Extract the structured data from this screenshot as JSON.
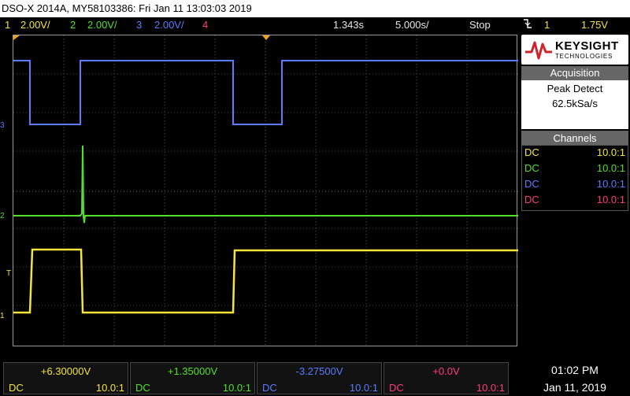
{
  "title": "DSO-X 2014A, MY58103386: Fri Jan 11 13:03:03 2019",
  "topbar": {
    "ch1": {
      "num": "1",
      "scale": "2.00V/"
    },
    "ch2": {
      "num": "2",
      "scale": "2.00V/"
    },
    "ch3": {
      "num": "3",
      "scale": "2.00V/"
    },
    "ch4": {
      "num": "4"
    },
    "time_delay": "1.343s",
    "time_scale": "5.000s/",
    "run_state": "Stop",
    "trigger_icon": "falling-edge-trigger-icon",
    "trigger_channel": "1",
    "trigger_level": "1.75V"
  },
  "markers": {
    "ch1": "1",
    "ch2": "2",
    "ch3": "3",
    "trigger": "T"
  },
  "logo": {
    "brand": "KEYSIGHT",
    "sub": "TECHNOLOGIES"
  },
  "acquisition": {
    "header": "Acquisition",
    "mode": "Peak Detect",
    "rate": "62.5kSa/s"
  },
  "channels": {
    "header": "Channels",
    "rows": [
      {
        "coupling": "DC",
        "ratio": "10.0:1"
      },
      {
        "coupling": "DC",
        "ratio": "10.0:1"
      },
      {
        "coupling": "DC",
        "ratio": "10.0:1"
      },
      {
        "coupling": "DC",
        "ratio": "10.0:1"
      }
    ]
  },
  "bottom": {
    "ch1": {
      "offset": "+6.30000V",
      "coupling": "DC",
      "ratio": "10.0:1"
    },
    "ch2": {
      "offset": "+1.35000V",
      "coupling": "DC",
      "ratio": "10.0:1"
    },
    "ch3": {
      "offset": "-3.27500V",
      "coupling": "DC",
      "ratio": "10.0:1"
    },
    "ch4": {
      "offset": "+0.0V",
      "coupling": "DC",
      "ratio": "10.0:1"
    }
  },
  "clock": {
    "time": "01:02 PM",
    "date": "Jan 11, 2019"
  },
  "colors": {
    "ch1": "#f5e53a",
    "ch2": "#52e02c",
    "ch3": "#5a7cff",
    "ch4": "#ff3a7a",
    "grid": "#5a5a5a",
    "accent_orange": "#f0a020"
  }
}
